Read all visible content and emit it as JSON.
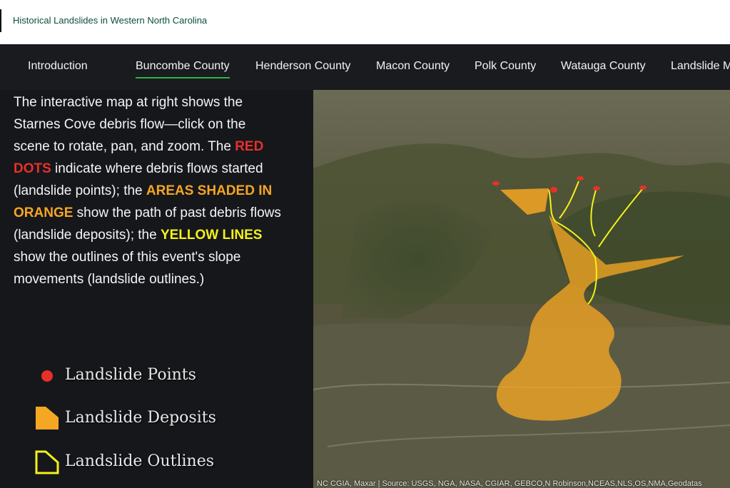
{
  "header": {
    "title": "Historical Landslides in Western North Carolina"
  },
  "nav": {
    "tabs": [
      {
        "label": "Introduction"
      },
      {
        "label": "Buncombe County",
        "active": true
      },
      {
        "label": "Henderson County"
      },
      {
        "label": "Macon County"
      },
      {
        "label": "Polk County"
      },
      {
        "label": "Watauga County"
      },
      {
        "label": "Landslide M"
      }
    ]
  },
  "description": {
    "p1": "The interactive map at right shows the Starnes Cove debris flow—click on the scene to rotate, pan, and zoom. The ",
    "red": "RED DOTS",
    "p2": " indicate where debris flows started (landslide points); the ",
    "orange": "AREAS SHADED IN ORANGE",
    "p3": " show the path of past debris flows (landslide deposits); the ",
    "yellow": "YELLOW LINES",
    "p4": " show the outlines of this event's slope movements (landslide outlines.)"
  },
  "legend": {
    "points": "Landslide Points",
    "deposits": "Landslide Deposits",
    "outlines": "Landslide Outlines"
  },
  "map": {
    "attribution": "NC CGIA, Maxar | Source: USGS, NGA, NASA, CGIAR, GEBCO,N Robinson,NCEAS,NLS,OS,NMA,Geodatas"
  },
  "colors": {
    "red_dots": "#e8302a",
    "deposit_orange": "#f5a623",
    "outline_yellow": "#f4f11a",
    "active_tab_underline": "#2fb24a"
  }
}
